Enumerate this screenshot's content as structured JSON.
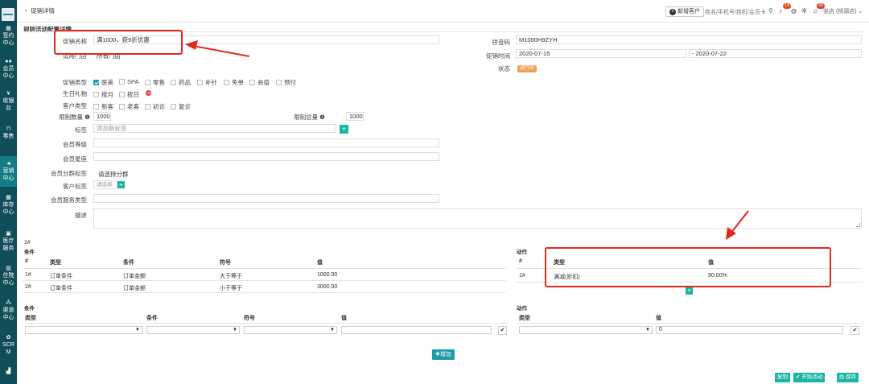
{
  "sidebar": {
    "items": [
      {
        "line1": "签约",
        "line2": "中心",
        "icon": "calendar-icon"
      },
      {
        "line1": "会员",
        "line2": "中心",
        "icon": "users-icon"
      },
      {
        "line1": "收银",
        "line2": "台",
        "icon": "yen-icon"
      },
      {
        "line1": "零售",
        "line2": "",
        "icon": "cart-icon"
      },
      {
        "line1": "营销",
        "line2": "中心",
        "icon": "megaphone-icon"
      },
      {
        "line1": "库存",
        "line2": "中心",
        "icon": "grid-icon"
      },
      {
        "line1": "医疗",
        "line2": "服务",
        "icon": "medical-bag-icon"
      },
      {
        "line1": "住院",
        "line2": "中心",
        "icon": "building-icon"
      },
      {
        "line1": "渠道",
        "line2": "中心",
        "icon": "sitemap-icon"
      },
      {
        "line1": "SCR",
        "line2": "M",
        "icon": "handshake-icon"
      },
      {
        "line1": "",
        "line2": "",
        "icon": "bar-chart-icon"
      }
    ]
  },
  "topbar": {
    "back_icon": "chevron-left-icon",
    "tab_title": "促销详情",
    "new_customer": "新增客户",
    "search_placeholder": "姓名/手机号/挂机/会员卡",
    "badge_messages": "14",
    "badge_notice": "99",
    "user_label": "张店 (桃源店)"
  },
  "form": {
    "section_title": "规则活动配置详情",
    "name_label": "促销名称",
    "name_value": "满1000，获9折优惠",
    "scope_label": "适用门店",
    "scope_value": "所有门店",
    "pinyin_label": "拼音码",
    "pinyin_value": "M1000H9ZYH",
    "time_label": "促销时间",
    "time_start": "2020-07-15",
    "time_end": "- 2020-07-22",
    "status_label": "状态",
    "status_value": "进行中",
    "type_label": "促销类型",
    "types": [
      {
        "label": "医美",
        "checked": true
      },
      {
        "label": "SPA",
        "checked": false
      },
      {
        "label": "零售",
        "checked": false
      },
      {
        "label": "药品",
        "checked": false
      },
      {
        "label": "补针",
        "checked": false
      },
      {
        "label": "免单",
        "checked": false
      },
      {
        "label": "充值",
        "checked": false
      },
      {
        "label": "预付",
        "checked": false
      }
    ],
    "birthday_label": "生日礼物",
    "birthday_opts": [
      "按月",
      "按日"
    ],
    "cust_type_label": "客户类型",
    "cust_types": [
      "新客",
      "老客",
      "初诊",
      "复诊"
    ],
    "limit_qty_label": "限制数量",
    "limit_qty_value": "1000",
    "limit_total_label": "限制总量",
    "limit_total_value": "1000",
    "tag_label": "标签",
    "tag_placeholder": "添加新标签",
    "member_level_label": "会员等级",
    "member_star_label": "会员星座",
    "member_group_label": "会员分群标签",
    "member_group_value": "请选择分群",
    "cust_tag_label": "客户标签",
    "cust_tag_placeholder": "请选择",
    "member_service_label": "会员服务类型",
    "desc_label": "描述"
  },
  "rules": {
    "group_no": "1#",
    "cond_title": "条件",
    "cond_headers": [
      "#",
      "类型",
      "条件",
      "符号",
      "值"
    ],
    "cond_rows": [
      [
        "1#",
        "订单条件",
        "订单金额",
        "大于等于",
        "1000.00"
      ],
      [
        "2#",
        "订单条件",
        "订单金额",
        "小于等于",
        "3000.00"
      ]
    ],
    "action_title": "动作",
    "action_headers": [
      "#",
      "类型",
      "值"
    ],
    "action_rows": [
      [
        "1#",
        "满减(折扣)",
        "90.00%"
      ]
    ],
    "new_cond_title": "条件",
    "new_cond_headers": [
      "类型",
      "条件",
      "符号",
      "值"
    ],
    "new_action_title": "动作",
    "new_action_headers": [
      "类型",
      "值"
    ],
    "new_action_value": "0",
    "add_label": "增加"
  },
  "footer": {
    "copy": "复制",
    "start": "开始活动",
    "save": "保存"
  }
}
